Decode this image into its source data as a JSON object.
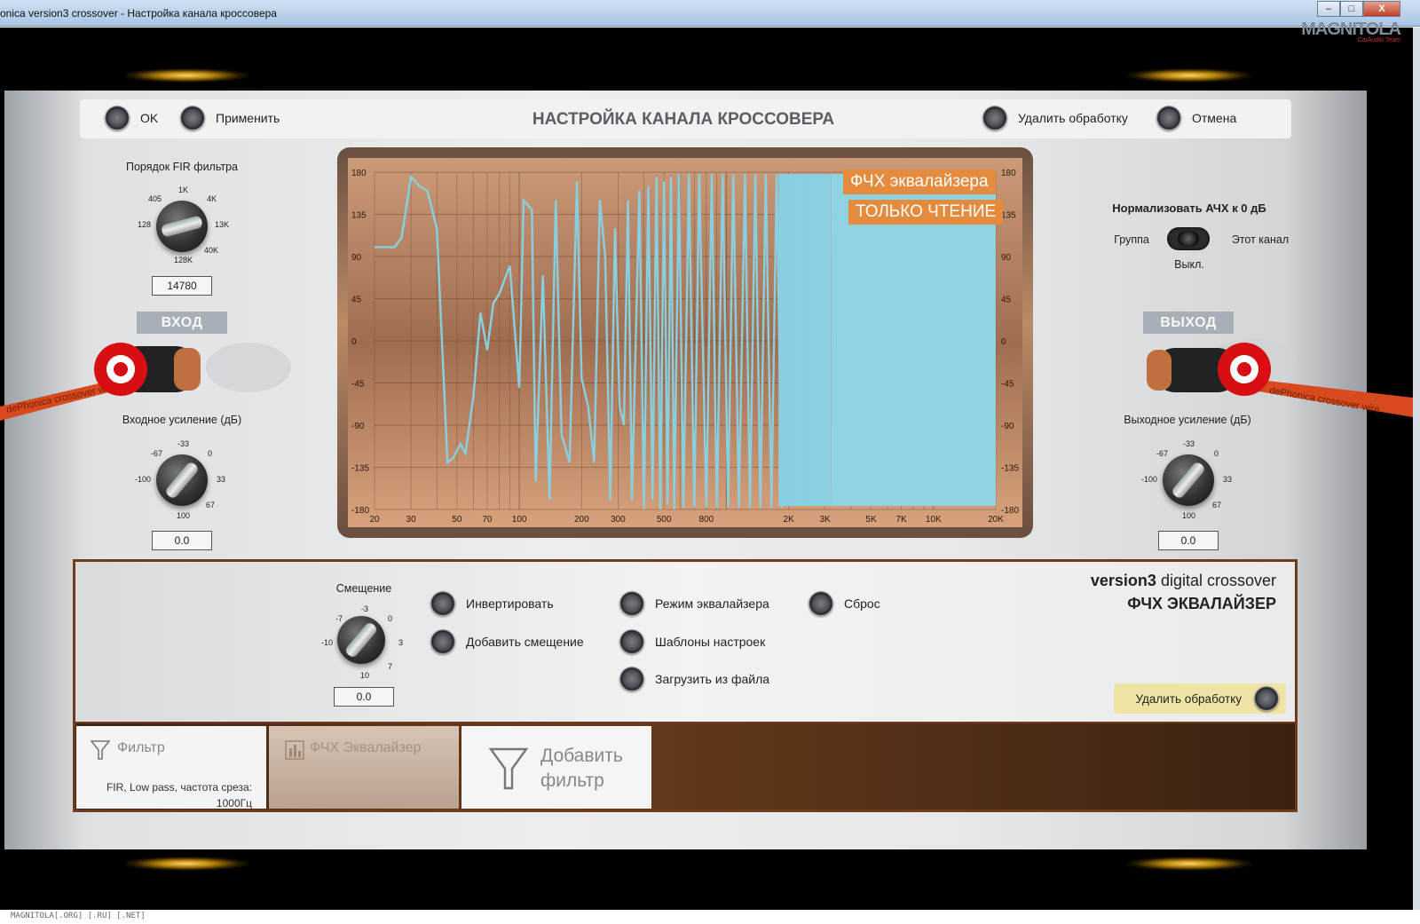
{
  "window": {
    "title": "onica version3 crossover - Настройка канала кроссовера",
    "min_label": "–",
    "max_label": "□",
    "close_label": "X",
    "brand": "MAGNITOLA",
    "brand_sub": "CarAudio Team"
  },
  "topbar": {
    "ok_label": "OK",
    "apply_label": "Применить",
    "title": "НАСТРОЙКА КАНАЛА КРОССОВЕРА",
    "remove_label": "Удалить обработку",
    "cancel_label": "Отмена"
  },
  "fir": {
    "label": "Порядок FIR фильтра",
    "ticks": [
      "405",
      "1K",
      "4K",
      "128",
      "13K",
      "40K",
      "128K"
    ],
    "value": "14780"
  },
  "input": {
    "tag": "ВХОД",
    "gain_label": "Входное усиление (дБ)",
    "ticks": [
      "-67",
      "-33",
      "0",
      "-100",
      "33",
      "67",
      "100"
    ],
    "value": "0.0",
    "cable_text": "dePhonica crossover wire"
  },
  "output": {
    "tag": "ВЫХОД",
    "gain_label": "Выходное усиление (дБ)",
    "ticks": [
      "-67",
      "-33",
      "0",
      "-100",
      "33",
      "67",
      "100"
    ],
    "value": "0.0",
    "cable_text": "dePhonica crossover wire"
  },
  "normalize": {
    "label": "Нормализовать АЧХ к 0 дБ",
    "left": "Группа",
    "right": "Этот канал",
    "state": "Выкл."
  },
  "graph": {
    "overlay1": "ФЧХ эквалайзера",
    "overlay2": "ТОЛЬКО ЧТЕНИЕ",
    "yticks": [
      "180",
      "135",
      "90",
      "45",
      "0",
      "-45",
      "-90",
      "-135",
      "-180"
    ],
    "xticks": [
      "20",
      "30",
      "50",
      "70",
      "100",
      "200",
      "300",
      "500",
      "800",
      "2K",
      "3K",
      "5K",
      "7K",
      "10K",
      "20K"
    ],
    "line_color": "#89cfe0",
    "fill_color": "#8fd2e2"
  },
  "bottom": {
    "shift_label": "Смещение",
    "shift_ticks": [
      "-7",
      "-3",
      "0",
      "-10",
      "3",
      "7",
      "10"
    ],
    "shift_value": "0.0",
    "invert_label": "Инвертировать",
    "add_shift_label": "Добавить смещение",
    "eq_mode_label": "Режим эквалайзера",
    "presets_label": "Шаблоны настроек",
    "load_label": "Загрузить из файла",
    "reset_label": "Сброс",
    "brand_bold": "version3",
    "brand_rest": " digital crossover",
    "section_title": "ФЧХ ЭКВАЛАЙЗЕР",
    "remove_label": "Удалить обработку"
  },
  "tabs": {
    "filter_title": "Фильтр",
    "filter_desc_1": "FIR, Low pass, частота среза:",
    "filter_desc_2": "1000Гц",
    "eq_title": "ФЧХ Эквалайзер",
    "add_line1": "Добавить",
    "add_line2": "фильтр"
  },
  "footer": "MAGNITOLA[.ORG] [.RU] [.NET]"
}
